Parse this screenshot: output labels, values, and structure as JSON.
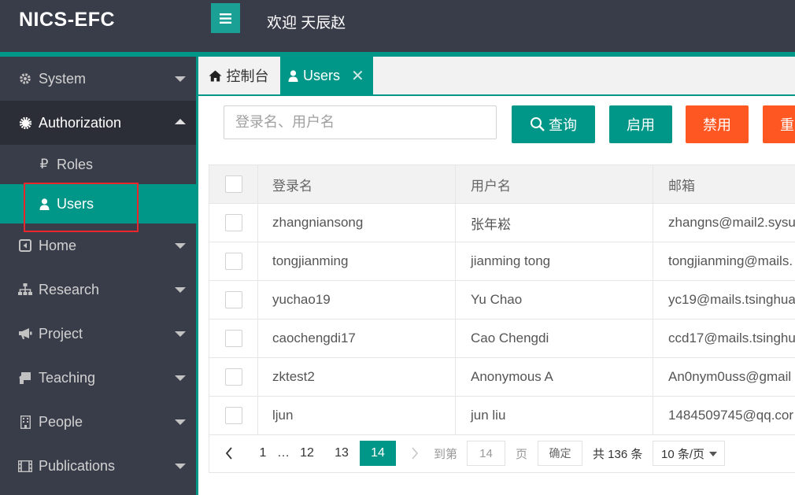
{
  "header": {
    "logo": "NICS-EFC",
    "welcome": "欢迎 天辰赵"
  },
  "sidebar": {
    "items": [
      {
        "label": "System",
        "icon": "gear-icon"
      },
      {
        "label": "Authorization",
        "icon": "cog-icon"
      },
      {
        "label": "Roles",
        "icon": "ruble-icon"
      },
      {
        "label": "Users",
        "icon": "user-icon"
      },
      {
        "label": "Home",
        "icon": "caret-square-icon"
      },
      {
        "label": "Research",
        "icon": "sitemap-icon"
      },
      {
        "label": "Project",
        "icon": "bullhorn-icon"
      },
      {
        "label": "Teaching",
        "icon": "chalkboard-icon"
      },
      {
        "label": "People",
        "icon": "building-icon"
      },
      {
        "label": "Publications",
        "icon": "film-icon"
      }
    ]
  },
  "tabs": [
    {
      "label": "控制台",
      "icon": "home-icon"
    },
    {
      "label": "Users",
      "icon": "user-icon"
    }
  ],
  "toolbar": {
    "search_placeholder": "登录名、用户名",
    "search_label": "查询",
    "enable_label": "启用",
    "disable_label": "禁用",
    "reset_label": "重"
  },
  "table": {
    "headers": [
      "登录名",
      "用户名",
      "邮箱"
    ],
    "rows": [
      [
        "zhangniansong",
        "张年崧",
        "zhangns@mail2.sysu"
      ],
      [
        "tongjianming",
        "jianming tong",
        "tongjianming@mails."
      ],
      [
        "yuchao19",
        "Yu Chao",
        "yc19@mails.tsinghua"
      ],
      [
        "caochengdi17",
        "Cao Chengdi",
        "ccd17@mails.tsinghu"
      ],
      [
        "zktest2",
        "Anonymous A",
        "An0nym0uss@gmail"
      ],
      [
        "ljun",
        "jun liu",
        "1484509745@qq.cor"
      ]
    ]
  },
  "pagination": {
    "first": "1",
    "ellipsis": "…",
    "pages": [
      "12",
      "13",
      "14"
    ],
    "current": "14",
    "goto_label": "到第",
    "goto_value": "14",
    "page_unit": "页",
    "confirm_label": "确定",
    "total": "共 136 条",
    "page_size": "10 条/页"
  },
  "colors": {
    "accent": "#009688",
    "danger": "#ff5722",
    "sidebar_bg": "#393d49"
  }
}
